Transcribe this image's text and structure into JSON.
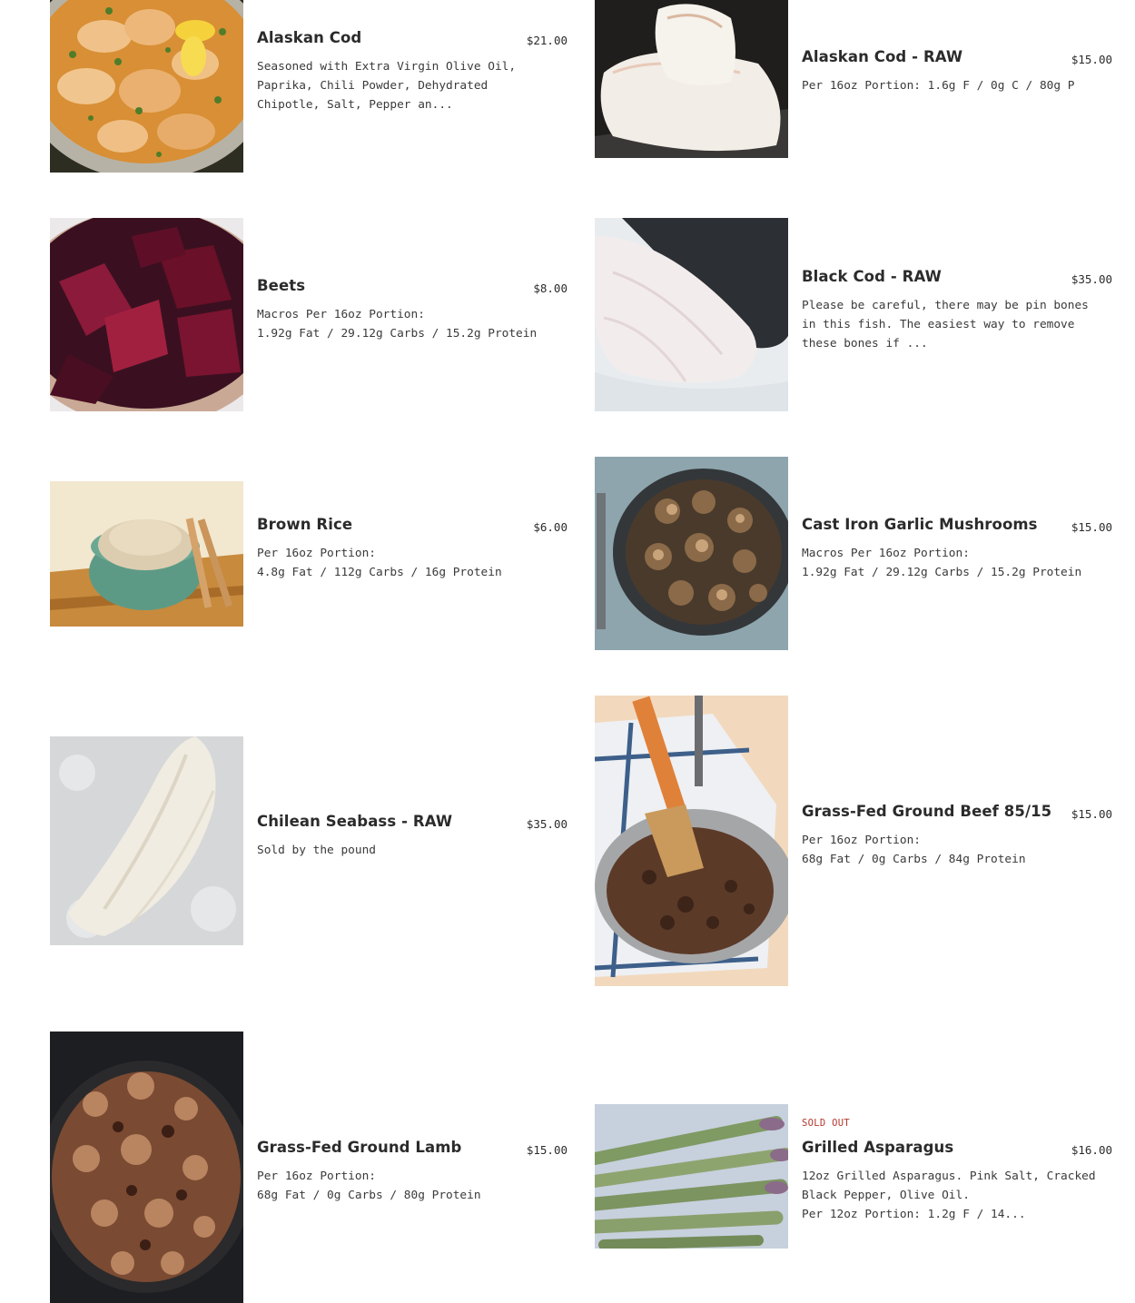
{
  "products": [
    {
      "title": "Alaskan Cod",
      "price": "$21.00",
      "desc": "Seasoned with Extra Virgin Olive Oil,\nPaprika, Chili Powder, Dehydrated\nChipotle, Salt, Pepper an...",
      "image": "baked-cod-with-lemon-photo"
    },
    {
      "title": "Alaskan Cod - RAW",
      "price": "$15.00",
      "desc": "Per 16oz Portion: 1.6g F / 0g C / 80g P",
      "image": "raw-cod-fillets-photo"
    },
    {
      "title": "Beets",
      "price": "$8.00",
      "desc": "Macros Per 16oz Portion:\n1.92g Fat / 29.12g Carbs / 15.2g Protein",
      "image": "roasted-beets-photo"
    },
    {
      "title": "Black Cod - RAW",
      "price": "$35.00",
      "desc": "Please be careful, there may be pin bones\nin this fish. The easiest way to remove\nthese bones if ...",
      "image": "raw-black-cod-photo"
    },
    {
      "title": "Brown Rice",
      "price": "$6.00",
      "desc": "Per 16oz Portion:\n4.8g Fat / 112g Carbs / 16g Protein",
      "image": "brown-rice-bowl-photo"
    },
    {
      "title": "Cast Iron Garlic Mushrooms",
      "price": "$15.00",
      "desc": "Macros Per 16oz Portion:\n1.92g Fat / 29.12g Carbs / 15.2g Protein",
      "image": "garlic-mushrooms-skillet-photo"
    },
    {
      "title": "Chilean Seabass - RAW",
      "price": "$35.00",
      "desc": "Sold by the pound",
      "image": "raw-seabass-fillet-photo"
    },
    {
      "title": "Grass-Fed Ground Beef 85/15",
      "price": "$15.00",
      "desc": "Per 16oz Portion:\n68g Fat / 0g Carbs / 84g Protein",
      "image": "ground-beef-pan-photo"
    },
    {
      "title": "Grass-Fed Ground Lamb",
      "price": "$15.00",
      "desc": "Per 16oz Portion:\n68g Fat / 0g Carbs / 80g Protein",
      "image": "ground-lamb-skillet-photo"
    },
    {
      "title": "Grilled Asparagus",
      "price": "$16.00",
      "desc": "12oz Grilled Asparagus. Pink Salt, Cracked\nBlack Pepper, Olive Oil.\nPer 12oz Portion: 1.2g F / 14...",
      "image": "grilled-asparagus-photo",
      "badge": "SOLD OUT"
    }
  ],
  "colors": {
    "sold_out": "#b5382c",
    "text": "#2b2b2b"
  }
}
